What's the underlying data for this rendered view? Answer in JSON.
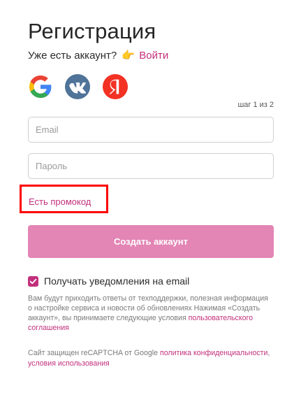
{
  "page": {
    "title": "Регистрация",
    "have_account_text": "Уже есть аккаунт?",
    "hand_icon": "👉",
    "login_link": "Войти"
  },
  "socials": [
    {
      "name": "google",
      "icon": "google-icon"
    },
    {
      "name": "vk",
      "icon": "vk-icon",
      "color": "#4f7399"
    },
    {
      "name": "yandex",
      "icon": "yandex-icon",
      "color": "#f33224",
      "letter": "Я"
    }
  ],
  "step_text": "шаг 1 из 2",
  "form": {
    "email_placeholder": "Email",
    "password_placeholder": "Пароль",
    "promo_link": "Есть промокод",
    "submit_label": "Создать аккаунт",
    "notify_label": "Получать уведомления на email",
    "notify_checked": true
  },
  "notice": {
    "text": "Вам будут приходить ответы от техподдержки, полезная информация о настройке сервиса и новости об обновлениях Нажимая «Создать аккаунт», вы принимаете следующие условия",
    "link": "пользовательского соглашения"
  },
  "captcha": {
    "text": "Сайт защищен reCAPTCHA от Google",
    "privacy_link": "политика конфиденциальности",
    "separator": ",",
    "terms_link": "условия использования"
  },
  "colors": {
    "accent": "#c2307c",
    "button": "#e385b5",
    "highlight": "#ff0000"
  }
}
